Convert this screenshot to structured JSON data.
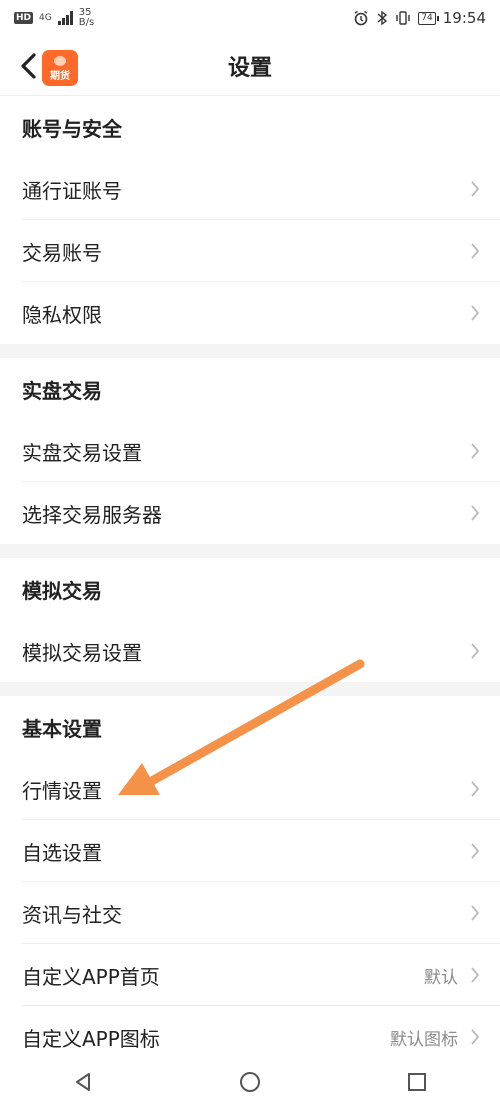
{
  "status_bar": {
    "hd": "HD",
    "network": "4G",
    "speed_value": "35",
    "speed_unit": "B/s",
    "battery": "74",
    "time": "19:54"
  },
  "header": {
    "title": "设置",
    "logo_text": "期货"
  },
  "sections": [
    {
      "title": "账号与安全",
      "items": [
        {
          "label": "通行证账号",
          "value": ""
        },
        {
          "label": "交易账号",
          "value": ""
        },
        {
          "label": "隐私权限",
          "value": ""
        }
      ]
    },
    {
      "title": "实盘交易",
      "items": [
        {
          "label": "实盘交易设置",
          "value": ""
        },
        {
          "label": "选择交易服务器",
          "value": ""
        }
      ]
    },
    {
      "title": "模拟交易",
      "items": [
        {
          "label": "模拟交易设置",
          "value": ""
        }
      ]
    },
    {
      "title": "基本设置",
      "items": [
        {
          "label": "行情设置",
          "value": ""
        },
        {
          "label": "自选设置",
          "value": ""
        },
        {
          "label": "资讯与社交",
          "value": ""
        },
        {
          "label": "自定义APP首页",
          "value": "默认"
        },
        {
          "label": "自定义APP图标",
          "value": "默认图标"
        }
      ]
    }
  ],
  "colors": {
    "accent": "#ff6a2a",
    "annotation_arrow": "#f5924a",
    "section_gap": "#f4f4f4",
    "value_text": "#8a8a8a"
  },
  "icons": {
    "back": "chevron-left-icon",
    "row_chevron": "chevron-right-icon",
    "nav_back": "triangle-back-icon",
    "nav_home": "circle-home-icon",
    "nav_recent": "square-recent-icon"
  }
}
